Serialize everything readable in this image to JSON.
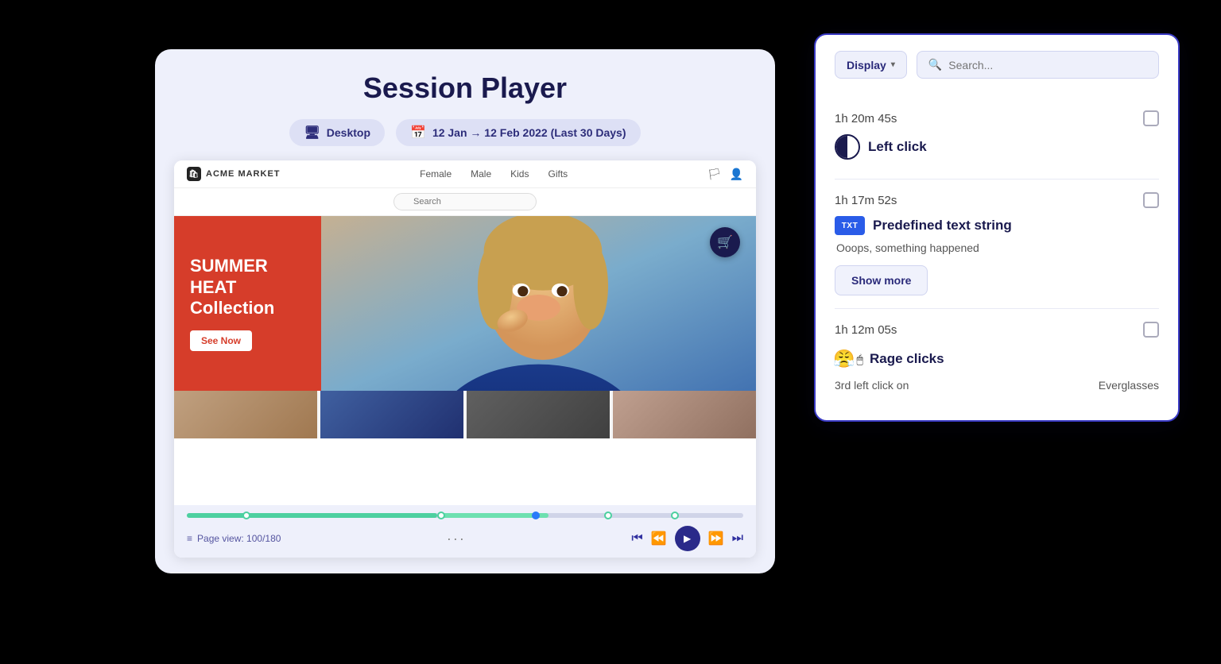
{
  "session_player": {
    "title": "Session Player",
    "device_btn": "Desktop",
    "date_range": "12 Jan → 12 Feb 2022 (Last 30 Days)",
    "brand": "ACME MARKET",
    "nav_items": [
      "Female",
      "Male",
      "Kids",
      "Gifts"
    ],
    "hero": {
      "title_line1": "SUMMER",
      "title_line2": "HEAT",
      "title_line3": "Collection",
      "cta": "See Now"
    },
    "page_view": "Page view: 100/180",
    "controls": {
      "dots": "···"
    }
  },
  "event_panel": {
    "display_btn": "Display",
    "search_placeholder": "Search...",
    "events": [
      {
        "time": "1h 20m 45s",
        "type": "left-click",
        "label": "Left click",
        "detail": null,
        "show_more": false
      },
      {
        "time": "1h 17m 52s",
        "type": "predefined-text",
        "label": "Predefined text string",
        "detail": "Ooops, something happened",
        "show_more": true,
        "show_more_label": "Show more"
      },
      {
        "time": "1h 12m 05s",
        "type": "rage-clicks",
        "label": "Rage clicks",
        "detail_left": "3rd left click on",
        "detail_right": "Everglasses",
        "show_more": false
      }
    ]
  }
}
